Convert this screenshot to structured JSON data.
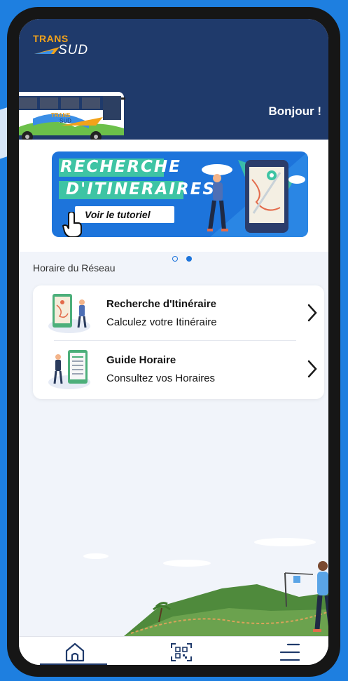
{
  "app": {
    "logo_top": "TRANS",
    "logo_bottom": "SUD",
    "greeting": "Bonjour !"
  },
  "banner": {
    "line1": "RECHERCHE",
    "line2": "D'ITINERAIRES",
    "tutorial_label": "Voir le tutoriel",
    "pagination": {
      "count": 2,
      "active": 2
    }
  },
  "section": {
    "title": "Horaire du Réseau",
    "items": [
      {
        "title": "Recherche d'Itinéraire",
        "subtitle": "Calculez votre Itinéraire",
        "icon": "map-search-icon"
      },
      {
        "title": "Guide Horaire",
        "subtitle": "Consultez vos Horaires",
        "icon": "timetable-icon"
      }
    ]
  },
  "bottom_nav": [
    {
      "name": "home",
      "icon": "home-icon",
      "active": true
    },
    {
      "name": "scan",
      "icon": "qr-scan-icon",
      "active": false
    },
    {
      "name": "menu",
      "icon": "menu-icon",
      "active": false
    }
  ],
  "colors": {
    "background": "#1e7fe0",
    "header": "#1f3a6b",
    "accent": "#1d74db",
    "logo_orange": "#f2a21a",
    "teal": "#3ec4a4"
  }
}
